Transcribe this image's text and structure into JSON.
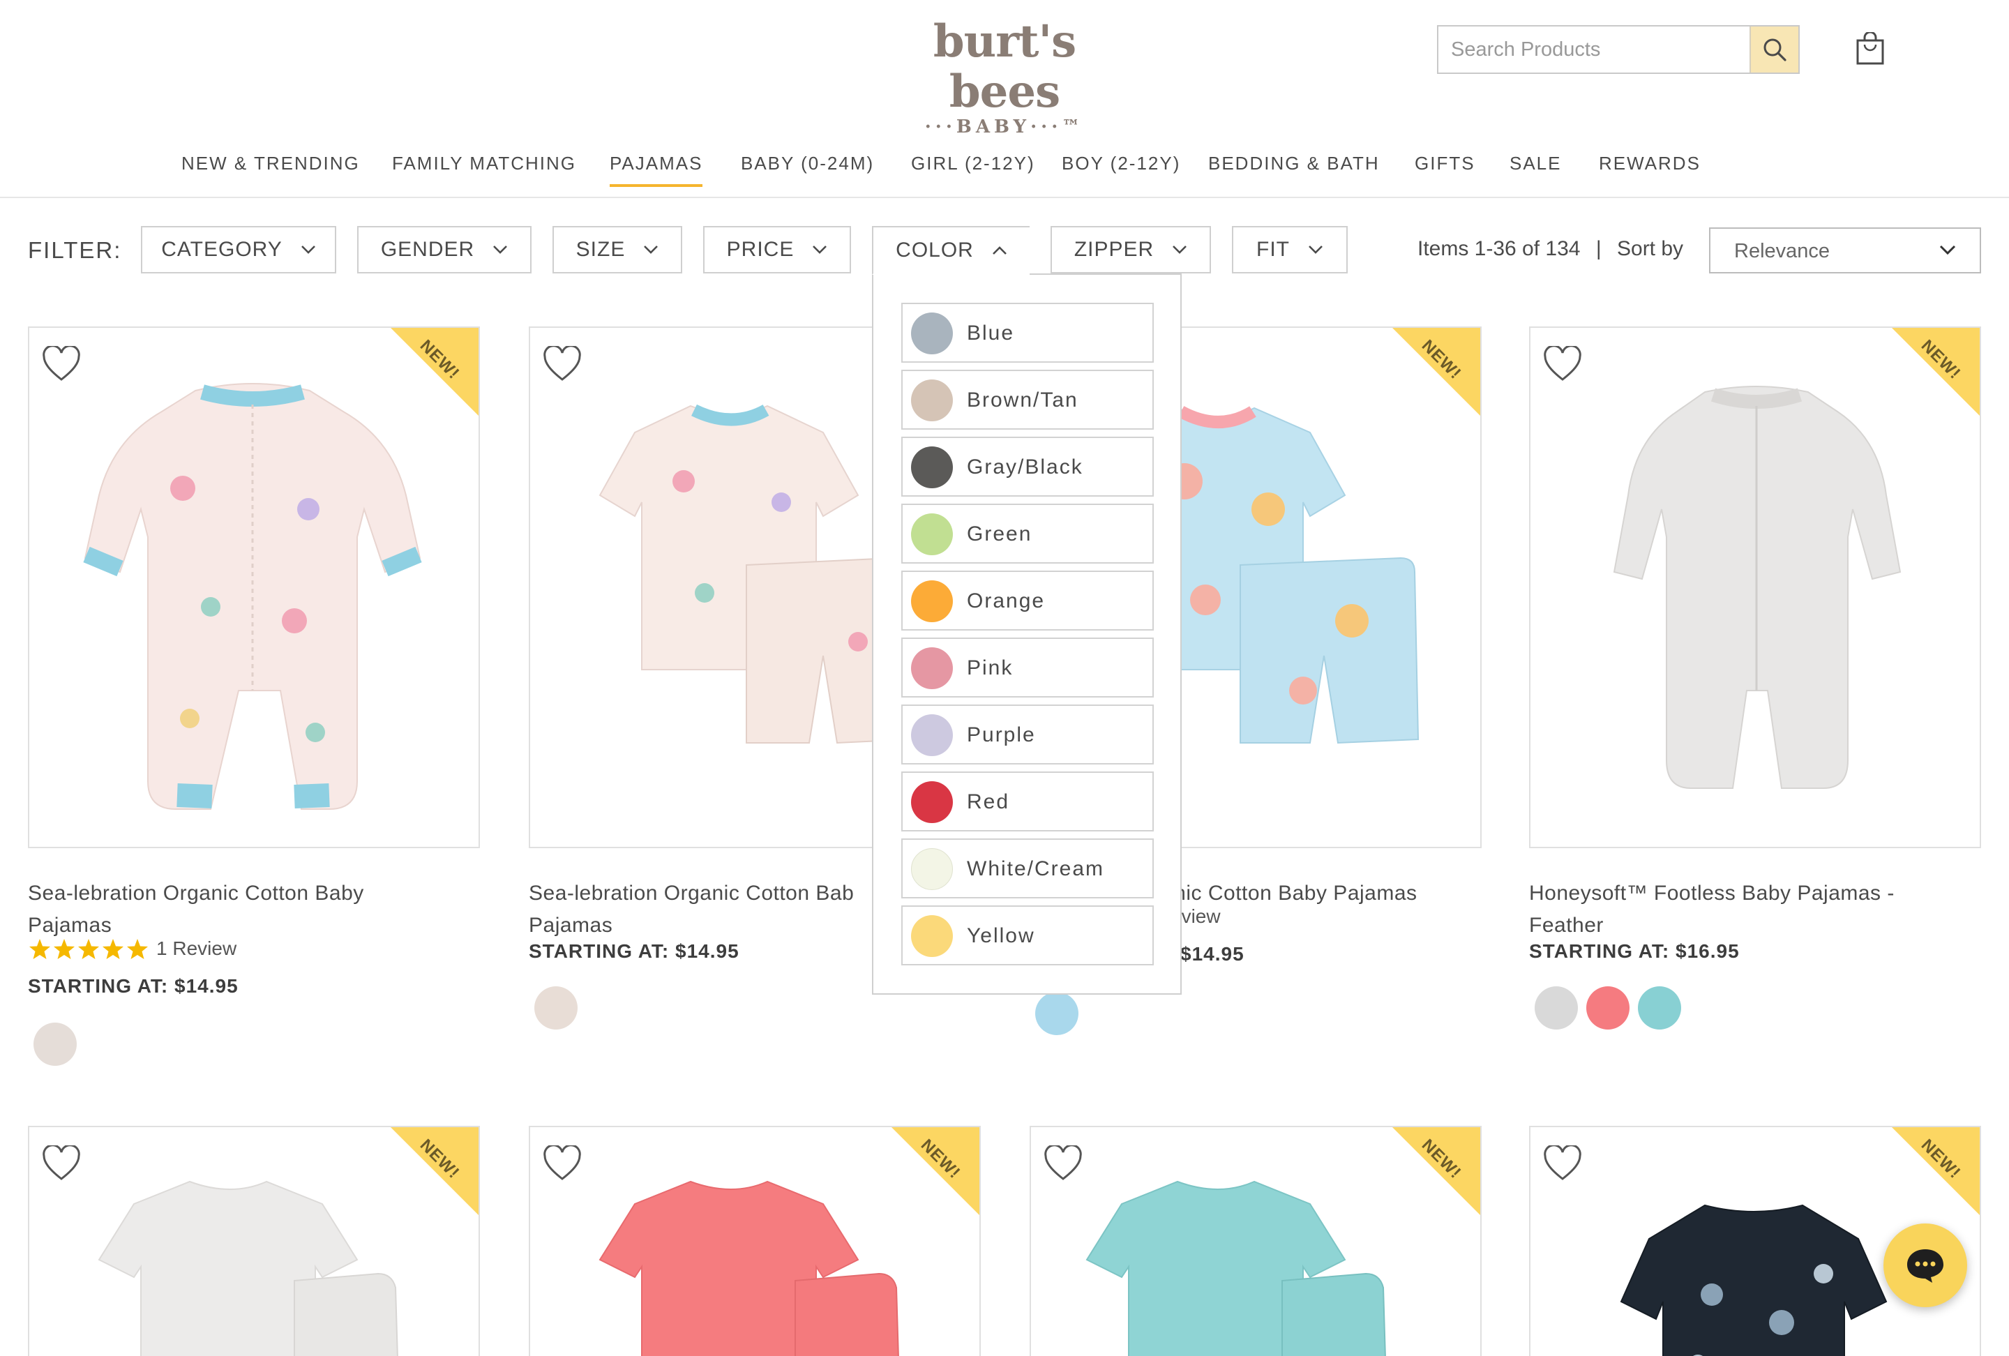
{
  "brand": {
    "name": "burt's bees",
    "sub": "···BABY···™"
  },
  "search": {
    "placeholder": "Search Products"
  },
  "nav": {
    "items": [
      "NEW & TRENDING",
      "FAMILY MATCHING",
      "PAJAMAS",
      "BABY (0-24M)",
      "GIRL (2-12Y)",
      "BOY (2-12Y)",
      "BEDDING & BATH",
      "GIFTS",
      "SALE",
      "REWARDS"
    ],
    "active": "PAJAMAS"
  },
  "filter": {
    "label": "FILTER:",
    "buttons": [
      "CATEGORY",
      "GENDER",
      "SIZE",
      "PRICE",
      "COLOR",
      "ZIPPER",
      "FIT"
    ],
    "open": "COLOR"
  },
  "results": {
    "count_text": "Items 1-36 of 134",
    "separator": "|",
    "sort_label": "Sort by",
    "sort_value": "Relevance"
  },
  "color_options": [
    {
      "name": "Blue",
      "color": "#a9b4be"
    },
    {
      "name": "Brown/Tan",
      "color": "#d5c4b6"
    },
    {
      "name": "Gray/Black",
      "color": "#5b5a58"
    },
    {
      "name": "Green",
      "color": "#c1df92"
    },
    {
      "name": "Orange",
      "color": "#fcab37"
    },
    {
      "name": "Pink",
      "color": "#e597a3"
    },
    {
      "name": "Purple",
      "color": "#cdc9e0"
    },
    {
      "name": "Red",
      "color": "#d93644"
    },
    {
      "name": "White/Cream",
      "color": "#f3f5e6"
    },
    {
      "name": "Yellow",
      "color": "#fbd97a"
    }
  ],
  "badge": "NEW!",
  "products": [
    {
      "name_line1": "Sea-lebration Organic Cotton Baby",
      "name_line2": "Pajamas",
      "review": "1 Review",
      "price": "STARTING AT: $14.95",
      "swatches": [
        "#e5ddd8"
      ]
    },
    {
      "name_line1": "Sea-lebration Organic Cotton Bab",
      "name_line2": "Pajamas",
      "price": "STARTING AT: $14.95",
      "swatches": [
        "#e8ddd6"
      ]
    },
    {
      "name_line1": "anic Cotton Baby Pajamas",
      "review": "eview",
      "price": "$14.95",
      "swatches": [
        "#a9d8ec"
      ]
    },
    {
      "name_line1": "Honeysoft™ Footless Baby Pajamas -",
      "name_line2": "Feather",
      "price": "STARTING AT: $16.95",
      "swatches": [
        "#d9d9d9",
        "#f57b80",
        "#88d0d3"
      ]
    }
  ]
}
